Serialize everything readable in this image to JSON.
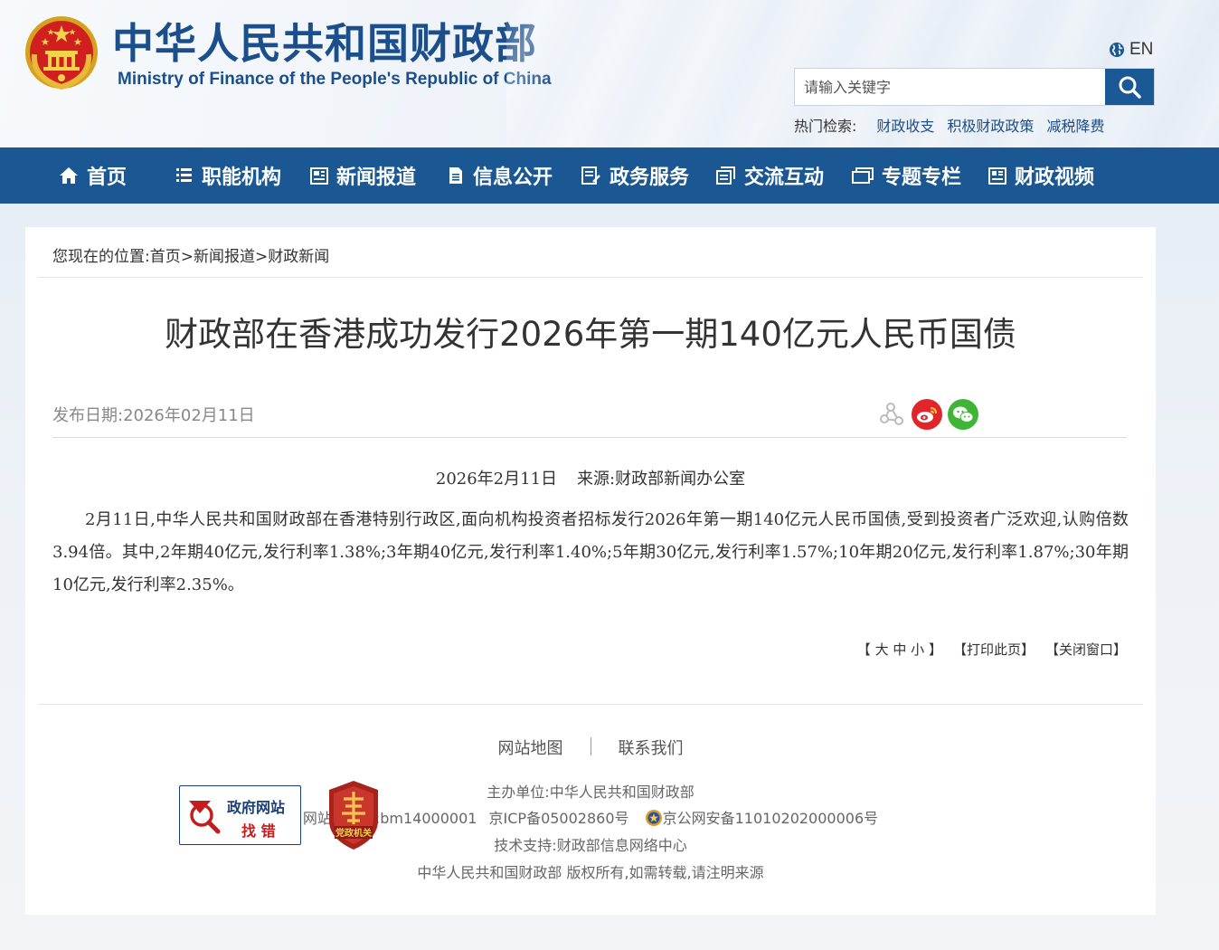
{
  "header": {
    "title_cn": "中华人民共和国财政部",
    "title_en": "Ministry of Finance of the People's Republic of China",
    "lang_label": "EN",
    "search_placeholder": "请输入关键字",
    "hot_label": "热门检索:",
    "hot_links": [
      "财政收支",
      "积极财政政策",
      "减税降费"
    ]
  },
  "nav": {
    "items": [
      {
        "label": "首页",
        "icon": "home-icon"
      },
      {
        "label": "职能机构",
        "icon": "list-icon"
      },
      {
        "label": "新闻报道",
        "icon": "newspaper-icon"
      },
      {
        "label": "信息公开",
        "icon": "document-icon"
      },
      {
        "label": "政务服务",
        "icon": "form-icon"
      },
      {
        "label": "交流互动",
        "icon": "chat-icon"
      },
      {
        "label": "专题专栏",
        "icon": "folder-icon"
      },
      {
        "label": "财政视频",
        "icon": "video-icon"
      }
    ]
  },
  "breadcrumb": {
    "prefix": "您现在的位置:",
    "items": [
      "首页",
      "新闻报道",
      "财政新闻"
    ],
    "separator": ">"
  },
  "article": {
    "title": "财政部在香港成功发行2026年第一期140亿元人民币国债",
    "pub_date": "发布日期:2026年02月11日",
    "meta_date": "2026年2月11日",
    "meta_source": "来源:财政部新闻办公室",
    "body": "2月11日,中华人民共和国财政部在香港特别行政区,面向机构投资者招标发行2026年第一期140亿元人民币国债,受到投资者广泛欢迎,认购倍数3.94倍。其中,2年期40亿元,发行利率1.38%;3年期40亿元,发行利率1.40%;5年期30亿元,发行利率1.57%;10年期20亿元,发行利率1.87%;30年期10亿元,发行利率2.35%。"
  },
  "share": {
    "icons": [
      "share-icon",
      "weibo-icon",
      "wechat-icon"
    ]
  },
  "tools": {
    "font_open": "【",
    "font_large": "大",
    "font_medium": "中",
    "font_small": "小",
    "font_close": "】",
    "print": "【打印此页】",
    "close": "【关闭窗口】"
  },
  "footer": {
    "sitemap": "网站地图",
    "contact": "联系我们",
    "sponsor": "主办单位:中华人民共和国财政部",
    "site_id": "网站标识码:bm14000001",
    "icp": "京ICP备05002860号",
    "police": "京公网安备11010202000006号",
    "tech": "技术支持:财政部信息网络中心",
    "copyright": "中华人民共和国财政部  版权所有,如需转载,请注明来源",
    "gov_badge_line1": "政府网站",
    "gov_badge_line2": "找 错",
    "party_badge_label": "党政机关"
  },
  "colors": {
    "nav_bg": "#1b5893",
    "brand_blue": "#1a4f8c",
    "search_btn": "#1a5896",
    "weibo_red": "#e0262b",
    "wechat_green": "#3fb536"
  }
}
